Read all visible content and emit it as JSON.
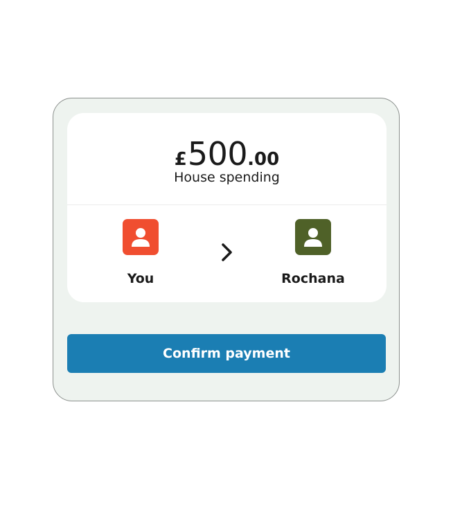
{
  "payment": {
    "currency_symbol": "£",
    "amount_whole": "500",
    "amount_cents": ".00",
    "description": "House spending"
  },
  "from": {
    "name": "You",
    "avatar_color": "#f04e30",
    "icon": "user-icon"
  },
  "to": {
    "name": "Rochana",
    "avatar_color": "#4f6128",
    "icon": "user-icon"
  },
  "direction_icon": "chevron-right-icon",
  "confirm_button": {
    "label": "Confirm payment",
    "color": "#1b7eb3"
  }
}
